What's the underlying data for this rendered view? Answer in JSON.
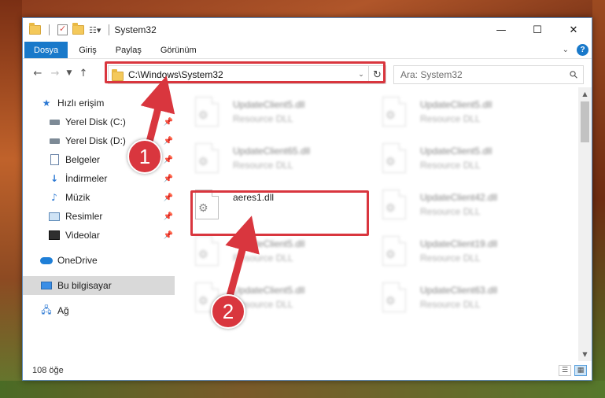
{
  "window": {
    "title": "System32",
    "controls": {
      "minimize": "—",
      "maximize": "☐",
      "close": "✕"
    }
  },
  "ribbon": {
    "tabs": [
      {
        "label": "Dosya",
        "active": true
      },
      {
        "label": "Giriş"
      },
      {
        "label": "Paylaş"
      },
      {
        "label": "Görünüm"
      }
    ],
    "help": "?"
  },
  "address": {
    "path": "C:\\Windows\\System32",
    "search_placeholder": "Ara: System32"
  },
  "sidebar": {
    "quick_access": "Hızlı erişim",
    "items": [
      {
        "label": "Yerel Disk (C:)",
        "icon": "drive-icon"
      },
      {
        "label": "Yerel Disk (D:)",
        "icon": "drive-icon"
      },
      {
        "label": "Belgeler",
        "icon": "documents-icon"
      },
      {
        "label": "İndirmeler",
        "icon": "downloads-icon"
      },
      {
        "label": "Müzik",
        "icon": "music-icon"
      },
      {
        "label": "Resimler",
        "icon": "pictures-icon"
      },
      {
        "label": "Videolar",
        "icon": "videos-icon"
      }
    ],
    "onedrive": "OneDrive",
    "this_pc": "Bu bilgisayar",
    "network": "Ağ"
  },
  "files": [
    {
      "name": "UpdateClient5.dll",
      "type": "Resource DLL",
      "blurred": true
    },
    {
      "name": "UpdateClient5.dll",
      "type": "Resource DLL",
      "blurred": true
    },
    {
      "name": "UpdateClient65.dll",
      "type": "Resource DLL",
      "blurred": true
    },
    {
      "name": "UpdateClient5.dll",
      "type": "Resource DLL",
      "blurred": true
    },
    {
      "name": "aeres1.dll",
      "type": "",
      "blurred": false
    },
    {
      "name": "UpdateClient42.dll",
      "type": "Resource DLL",
      "blurred": true
    },
    {
      "name": "UpdateClient5.dll",
      "type": "Resource DLL",
      "blurred": true
    },
    {
      "name": "UpdateClient19.dll",
      "type": "Resource DLL",
      "blurred": true
    },
    {
      "name": "UpdateClient5.dll",
      "type": "Resource DLL",
      "blurred": true
    },
    {
      "name": "UpdateClient63.dll",
      "type": "Resource DLL",
      "blurred": true
    }
  ],
  "status": {
    "count": "108 öğe"
  },
  "annotations": {
    "step1": "1",
    "step2": "2",
    "highlight_color": "#d9363e"
  }
}
